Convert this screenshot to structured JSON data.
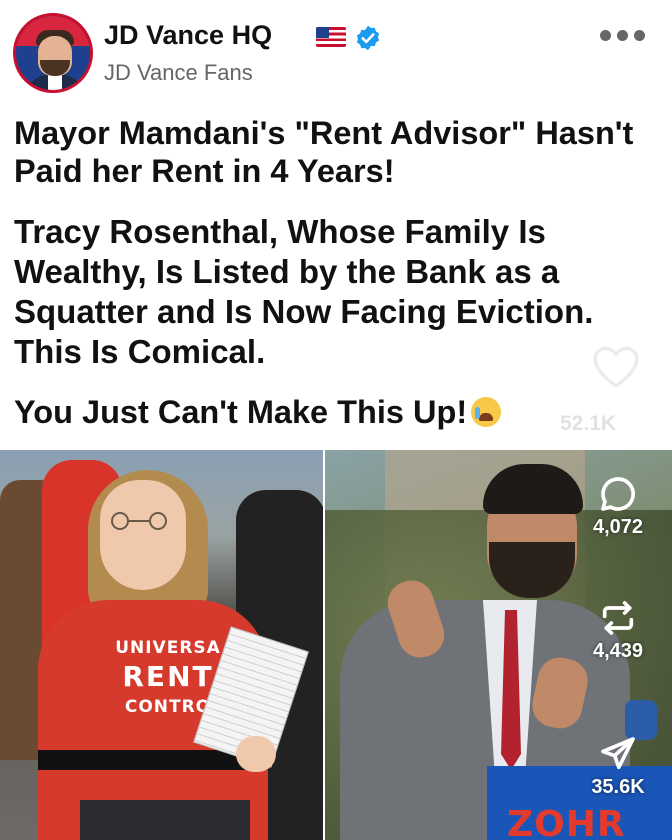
{
  "post": {
    "account_name": "JD Vance HQ",
    "account_subtitle": "JD Vance Fans",
    "headline_1": "Mayor Mamdani's \"Rent Advisor\" Hasn't Paid her Rent in 4 Years!",
    "headline_2": "Tracy Rosenthal, Whose Family Is Wealthy, Is Listed by the Bank as a Squatter and Is Now Facing Eviction. This Is Comical.",
    "headline_3": "You Just Can't Make This Up!",
    "faded_likes": "52.1K"
  },
  "photo_text": {
    "shirt_line_1": "UNIVERSA",
    "shirt_line_2": "RENT",
    "shirt_line_3": "CONTRO",
    "podium_text": "ZOHR"
  },
  "actions": {
    "comments": "4,072",
    "reposts": "4,439",
    "shares": "35.6K"
  },
  "icons": {
    "verified": "verified-check-icon",
    "flag": "us-flag-icon",
    "more": "more-options-icon",
    "like": "heart-icon",
    "comment": "comment-icon",
    "repost": "repost-icon",
    "share": "share-icon",
    "emoji": "crying-laughing-emoji"
  },
  "colors": {
    "verified_blue": "#1d9bf0",
    "text": "#111111",
    "subtitle": "#666666"
  }
}
